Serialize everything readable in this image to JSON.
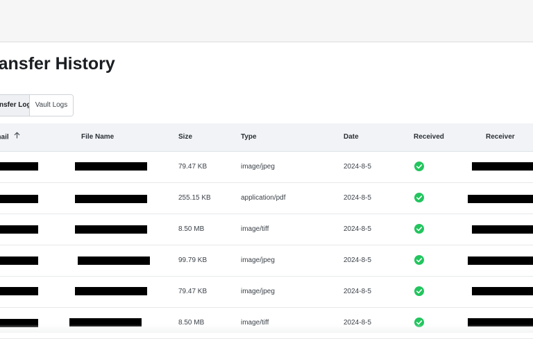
{
  "header": {
    "title": "Transfer History"
  },
  "tabs": [
    {
      "label": "Transfer Logs",
      "active": true
    },
    {
      "label": "Vault Logs",
      "active": false
    }
  ],
  "table": {
    "columns": {
      "email": "Email",
      "file_name": "File Name",
      "size": "Size",
      "type": "Type",
      "date": "Date",
      "received": "Received",
      "receiver": "Receiver"
    },
    "sort": {
      "column": "Email",
      "direction": "ascending",
      "icon": "arrow-up-icon"
    },
    "rows": [
      {
        "email": "[redacted]",
        "file_name": "[redacted]",
        "size": "79.47 KB",
        "type": "image/jpeg",
        "date": "2024-8-5",
        "received": true,
        "receiver": "[redacted]"
      },
      {
        "email": "[redacted]",
        "file_name": "[redacted]",
        "size": "255.15 KB",
        "type": "application/pdf",
        "date": "2024-8-5",
        "received": true,
        "receiver": "[redacted]"
      },
      {
        "email": "[redacted]",
        "file_name": "[redacted]",
        "size": "8.50 MB",
        "type": "image/tiff",
        "date": "2024-8-5",
        "received": true,
        "receiver": "[redacted]"
      },
      {
        "email": "[redacted]",
        "file_name": "[redacted]",
        "size": "99.79 KB",
        "type": "image/jpeg",
        "date": "2024-8-5",
        "received": true,
        "receiver": "[redacted]"
      },
      {
        "email": "[redacted]",
        "file_name": "[redacted]",
        "size": "79.47 KB",
        "type": "image/jpeg",
        "date": "2024-8-5",
        "received": true,
        "receiver": "[redacted]"
      },
      {
        "email": "[redacted]",
        "file_name": "[redacted]",
        "size": "8.50 MB",
        "type": "image/tiff",
        "date": "2024-8-5",
        "received": true,
        "receiver": "[redacted]"
      }
    ]
  },
  "colors": {
    "received_check": "#22c55e",
    "header_bg": "#f1f3f6",
    "redaction": "#000000"
  }
}
